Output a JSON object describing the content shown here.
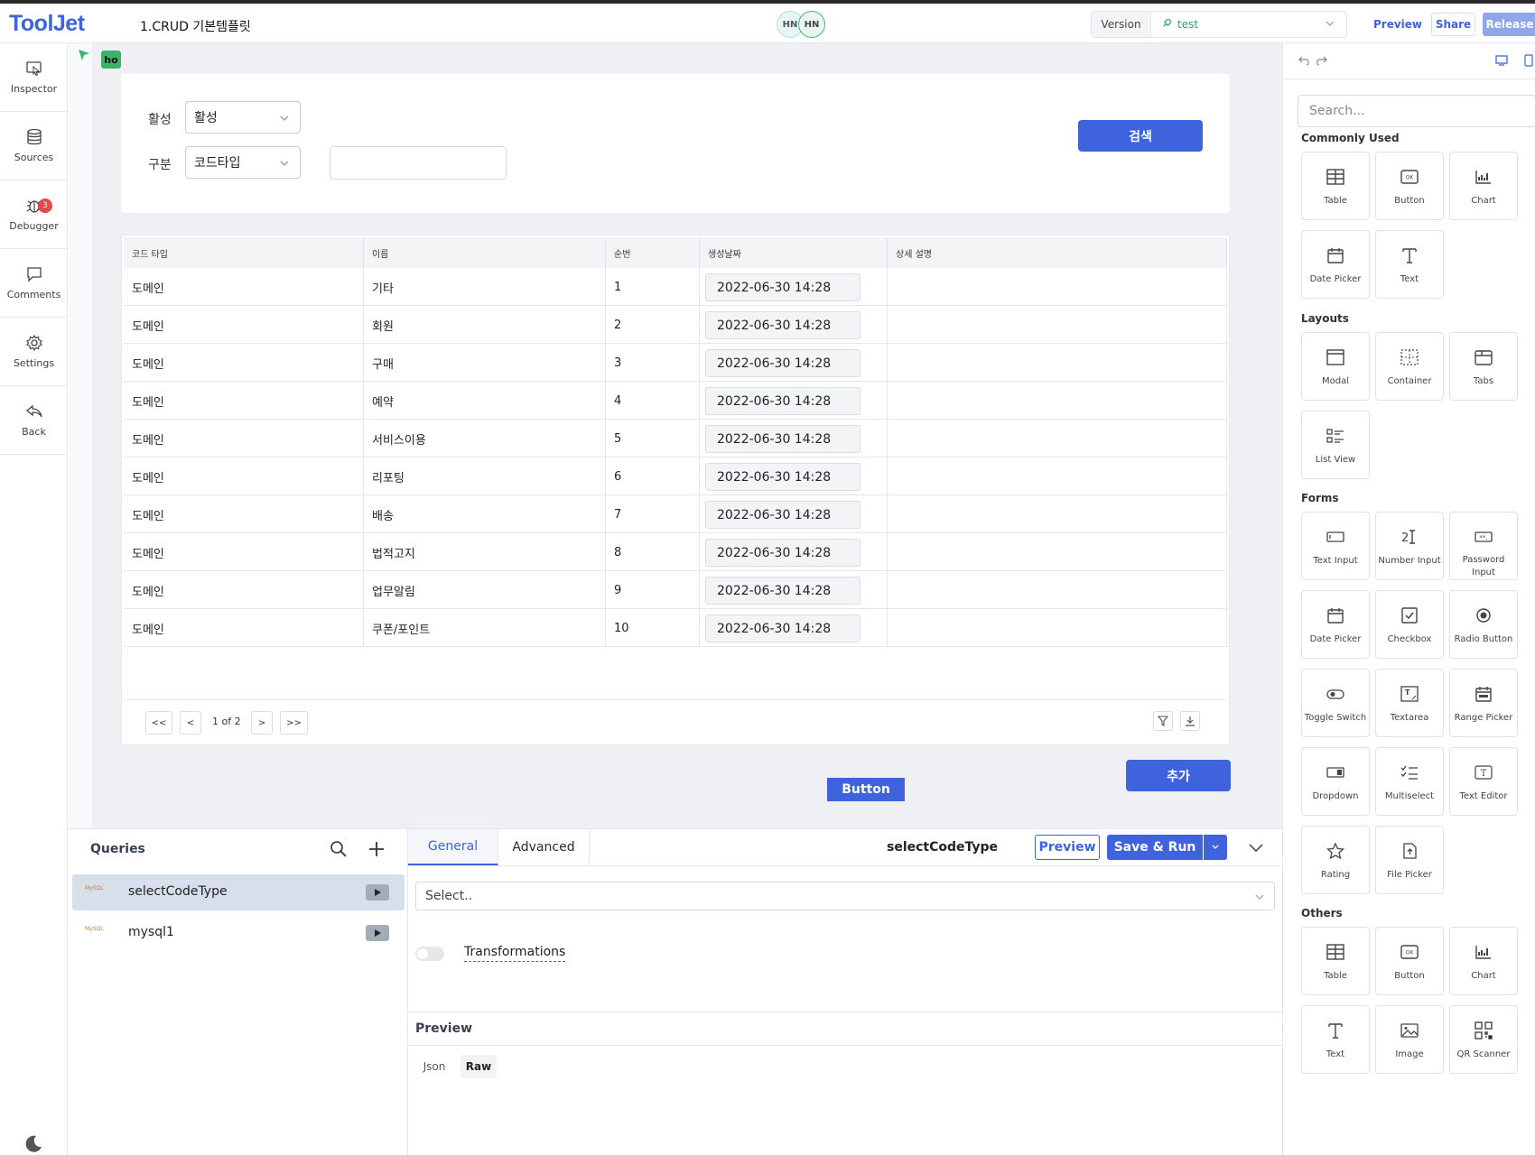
{
  "header": {
    "logo": "ToolJet",
    "app_name": "1.CRUD 기본템플릿",
    "avatars": [
      "HN",
      "HN"
    ],
    "version_label": "Version",
    "version_value": "test",
    "preview": "Preview",
    "share": "Share",
    "release": "Release"
  },
  "rail": {
    "items": [
      {
        "label": "Inspector",
        "icon": "inspector-icon"
      },
      {
        "label": "Sources",
        "icon": "database-icon"
      },
      {
        "label": "Debugger",
        "icon": "bug-icon",
        "badge": "3"
      },
      {
        "label": "Comments",
        "icon": "comment-icon"
      },
      {
        "label": "Settings",
        "icon": "gear-icon"
      },
      {
        "label": "Back",
        "icon": "back-icon"
      }
    ]
  },
  "canvas": {
    "tag": "ho",
    "search": {
      "active_label": "활성",
      "active_value": "활성",
      "type_label": "구분",
      "type_value": "코드타입",
      "search_button": "검색"
    },
    "table": {
      "columns": [
        "코드 타입",
        "이름",
        "순번",
        "생성날짜",
        "상세 설명"
      ],
      "rows": [
        [
          "도메인",
          "기타",
          "1",
          "2022-06-30 14:28",
          ""
        ],
        [
          "도메인",
          "회원",
          "2",
          "2022-06-30 14:28",
          ""
        ],
        [
          "도메인",
          "구매",
          "3",
          "2022-06-30 14:28",
          ""
        ],
        [
          "도메인",
          "예약",
          "4",
          "2022-06-30 14:28",
          ""
        ],
        [
          "도메인",
          "서비스이용",
          "5",
          "2022-06-30 14:28",
          ""
        ],
        [
          "도메인",
          "리포팅",
          "6",
          "2022-06-30 14:28",
          ""
        ],
        [
          "도메인",
          "배송",
          "7",
          "2022-06-30 14:28",
          ""
        ],
        [
          "도메인",
          "법적고지",
          "8",
          "2022-06-30 14:28",
          ""
        ],
        [
          "도메인",
          "업무알림",
          "9",
          "2022-06-30 14:28",
          ""
        ],
        [
          "도메인",
          "쿠폰/포인트",
          "10",
          "2022-06-30 14:28",
          ""
        ]
      ],
      "pagination": {
        "first": "<<",
        "prev": "<",
        "info": "1 of 2",
        "next": ">",
        "last": ">>"
      }
    },
    "add_button": "추가",
    "button": "Button"
  },
  "queries": {
    "title": "Queries",
    "items": [
      {
        "name": "selectCodeType",
        "active": true
      },
      {
        "name": "mysql1",
        "active": false
      }
    ],
    "source_logo": "MySQL"
  },
  "editor": {
    "tabs": [
      "General",
      "Advanced"
    ],
    "query_name": "selectCodeType",
    "preview": "Preview",
    "save_run": "Save & Run",
    "select_placeholder": "Select..",
    "transformations": "Transformations",
    "preview_title": "Preview",
    "preview_tabs": [
      "Json",
      "Raw"
    ]
  },
  "widgets": {
    "search_placeholder": "Search...",
    "sections": [
      {
        "title": "Commonly Used",
        "items": [
          "Table",
          "Button",
          "Chart",
          "Date Picker",
          "Text"
        ]
      },
      {
        "title": "Layouts",
        "items": [
          "Modal",
          "Container",
          "Tabs",
          "List View"
        ]
      },
      {
        "title": "Forms",
        "items": [
          "Text Input",
          "Number Input",
          "Password Input",
          "Date Picker",
          "Checkbox",
          "Radio Button",
          "Toggle Switch",
          "Textarea",
          "Range Picker",
          "Dropdown",
          "Multiselect",
          "Text Editor",
          "Rating",
          "File Picker"
        ]
      },
      {
        "title": "Others",
        "items": [
          "Table",
          "Button",
          "Chart",
          "Text",
          "Image",
          "QR Scanner"
        ]
      }
    ]
  },
  "colors": {
    "accent": "#3e63dd",
    "green": "#3bb36b",
    "danger": "#e5484d"
  }
}
